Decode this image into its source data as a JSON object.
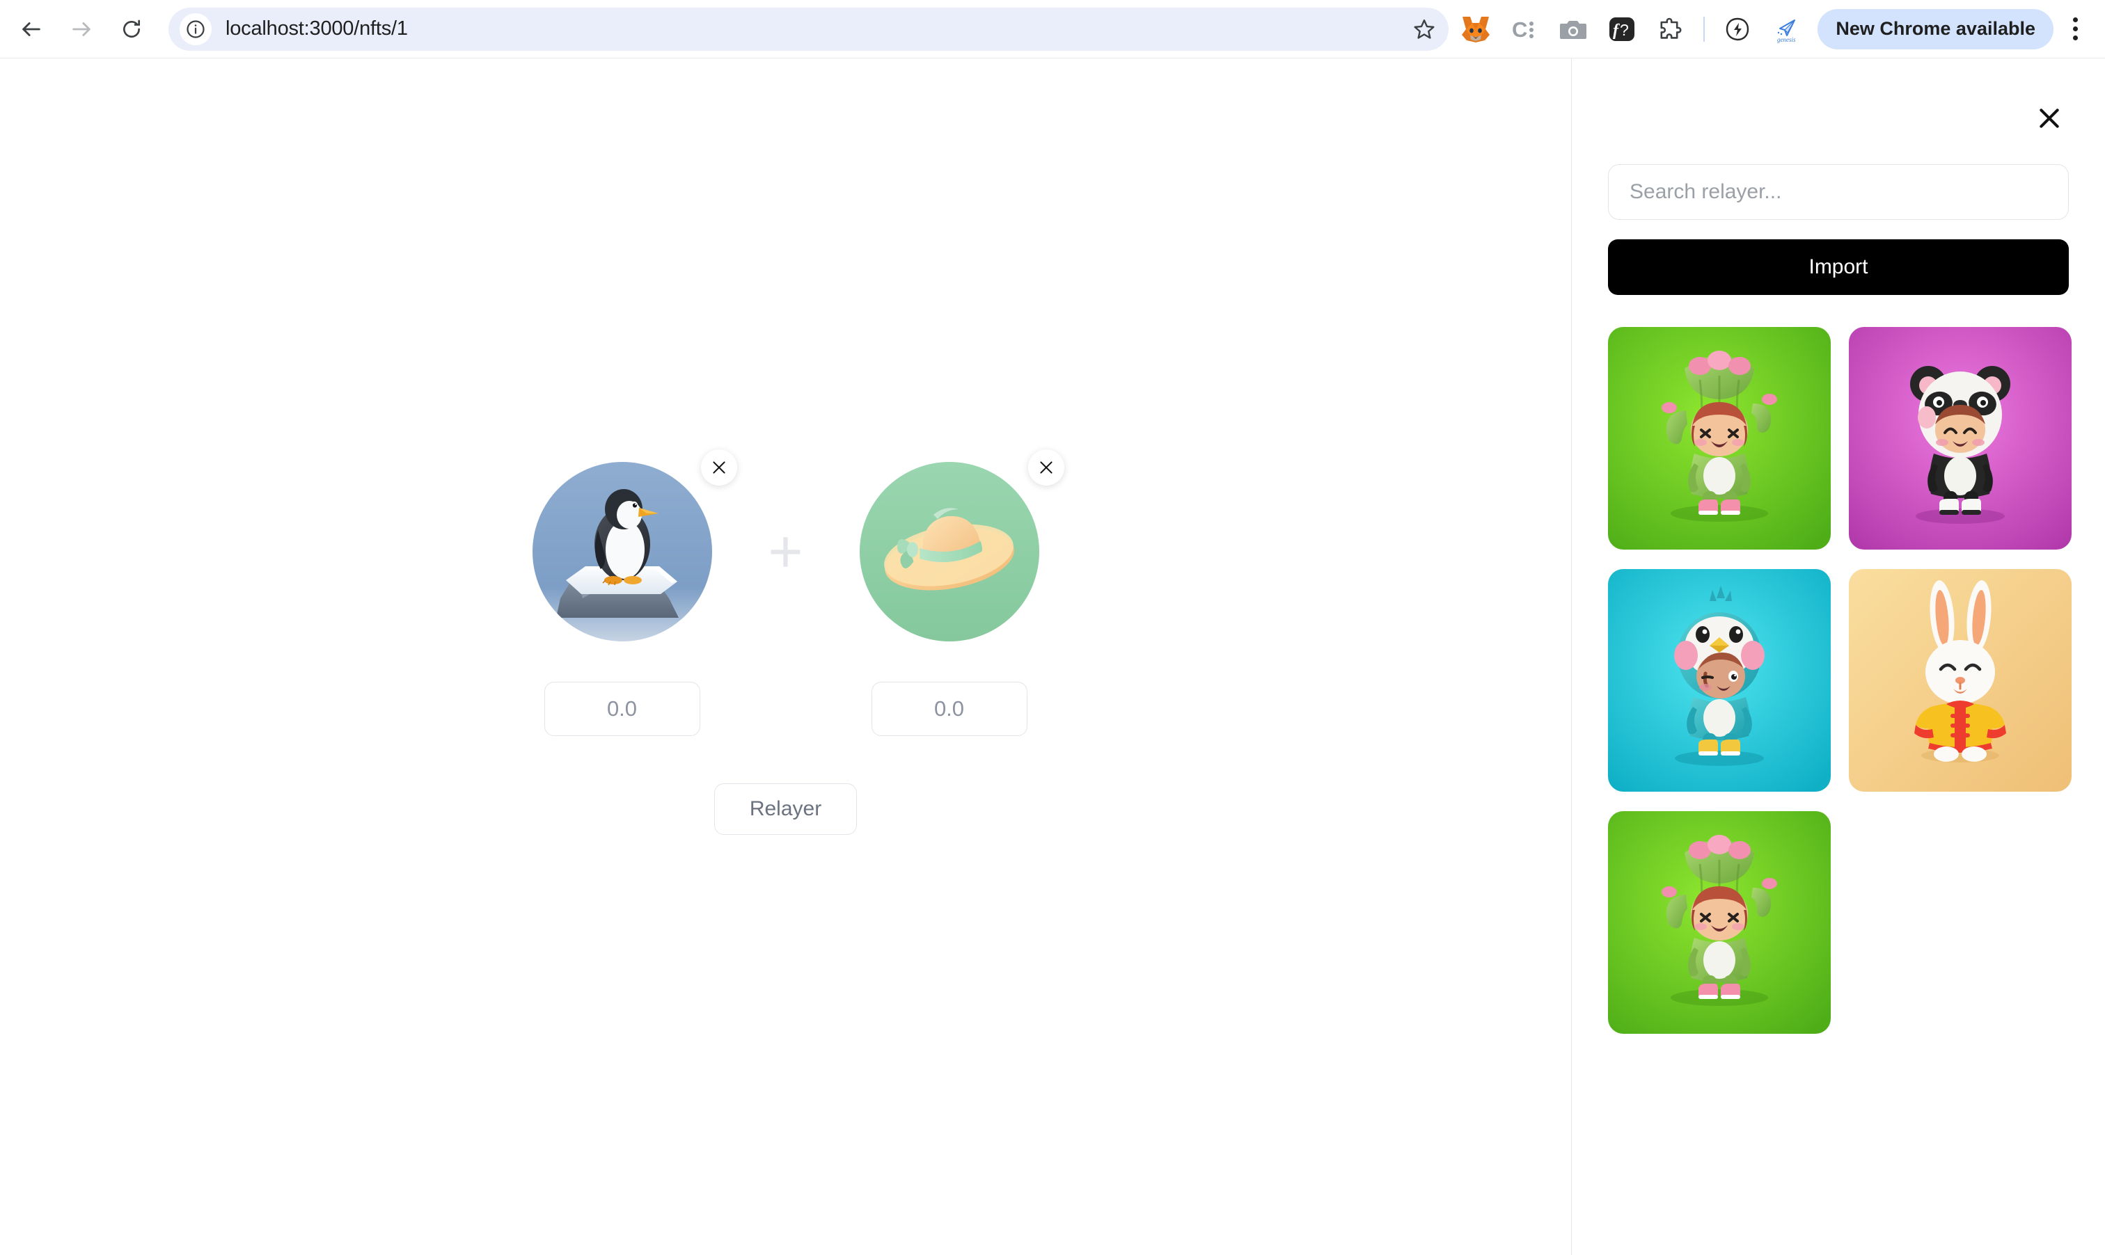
{
  "browser": {
    "back_label": "Back",
    "forward_label": "Forward",
    "reload_label": "Reload",
    "url": "localhost:3000/nfts/1",
    "site_info_label": "View site information",
    "bookmark_label": "Bookmark this tab",
    "extensions": [
      {
        "name": "metamask-icon",
        "label": "MetaMask"
      },
      {
        "name": "coinbase-wallet-icon",
        "label": "C:"
      },
      {
        "name": "camera-icon",
        "label": "Screenshot"
      },
      {
        "name": "formula-icon",
        "label": "f?"
      },
      {
        "name": "puzzle-icon",
        "label": "Extensions"
      },
      {
        "name": "lightning-leaf-icon",
        "label": "Flash"
      },
      {
        "name": "genesis-icon",
        "label": "genesis"
      }
    ],
    "update_chip": "New Chrome available",
    "menu_label": "Customize and control Google Chrome"
  },
  "main": {
    "tokens": [
      {
        "name": "penguin-nft",
        "alt": "Penguin on iceberg",
        "bg": "#7fa0c6",
        "amount_placeholder": "0.0",
        "amount_value": "",
        "remove_label": "Remove"
      },
      {
        "name": "hat-nft",
        "alt": "Straw sun hat with green band",
        "bg": "#8ecfa7",
        "amount_placeholder": "0.0",
        "amount_value": "",
        "remove_label": "Remove"
      }
    ],
    "plus_symbol": "+",
    "relayer_button": "Relayer"
  },
  "panel": {
    "close_label": "Close",
    "search_placeholder": "Search relayer...",
    "search_value": "",
    "import_button": "Import",
    "nfts": [
      {
        "name": "cactus-kid-nft",
        "alt": "Cactus costume character",
        "bg_from": "#86e02a",
        "bg_to": "#4aa816",
        "variant": "cactus"
      },
      {
        "name": "panda-kid-nft",
        "alt": "Panda costume character",
        "bg_from": "#e868d8",
        "bg_to": "#b53bb0",
        "variant": "panda"
      },
      {
        "name": "bird-kid-nft",
        "alt": "Bird costume character",
        "bg_from": "#2ed9e8",
        "bg_to": "#12b3c9",
        "variant": "bird"
      },
      {
        "name": "bunny-nft",
        "alt": "Bunny in yellow jacket",
        "bg_from": "#f6d79a",
        "bg_to": "#f0c478",
        "variant": "bunny"
      },
      {
        "name": "cactus-kid-nft-2",
        "alt": "Cactus costume character",
        "bg_from": "#86e02a",
        "bg_to": "#4aa816",
        "variant": "cactus"
      }
    ]
  },
  "colors": {
    "omnibox_bg": "#eaeefb",
    "chip_bg": "#d3e2fd",
    "import_bg": "#000000",
    "border": "#e2e5e9"
  }
}
